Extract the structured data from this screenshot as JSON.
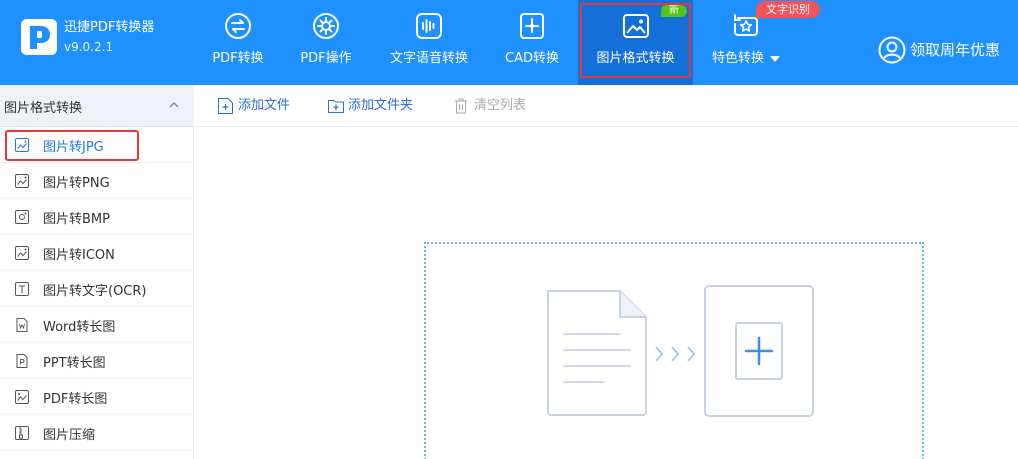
{
  "app": {
    "name": "迅捷PDF转换器",
    "version": "v9.0.2.1"
  },
  "nav": {
    "items": [
      {
        "label": "PDF转换"
      },
      {
        "label": "PDF操作"
      },
      {
        "label": "文字语音转换"
      },
      {
        "label": "CAD转换"
      },
      {
        "label": "图片格式转换",
        "badge": "新"
      },
      {
        "label": "特色转换"
      }
    ],
    "ocr_badge": "文字识别",
    "promo": "领取周年优惠"
  },
  "sidebar": {
    "section_title": "图片格式转换",
    "items": [
      {
        "label": "图片转JPG"
      },
      {
        "label": "图片转PNG"
      },
      {
        "label": "图片转BMP"
      },
      {
        "label": "图片转ICON"
      },
      {
        "label": "图片转文字(OCR)"
      },
      {
        "label": "Word转长图"
      },
      {
        "label": "PPT转长图"
      },
      {
        "label": "PDF转长图"
      },
      {
        "label": "图片压缩"
      }
    ]
  },
  "toolbar": {
    "add_file": "添加文件",
    "add_folder": "添加文件夹",
    "clear_list": "清空列表"
  },
  "colors": {
    "brand_blue": "#1e90ff",
    "active_nav": "#1470d8",
    "highlight_red": "#e03a3a",
    "badge_green": "#52c41a",
    "badge_red": "#f5535b",
    "link_blue": "#2b6fcf"
  }
}
